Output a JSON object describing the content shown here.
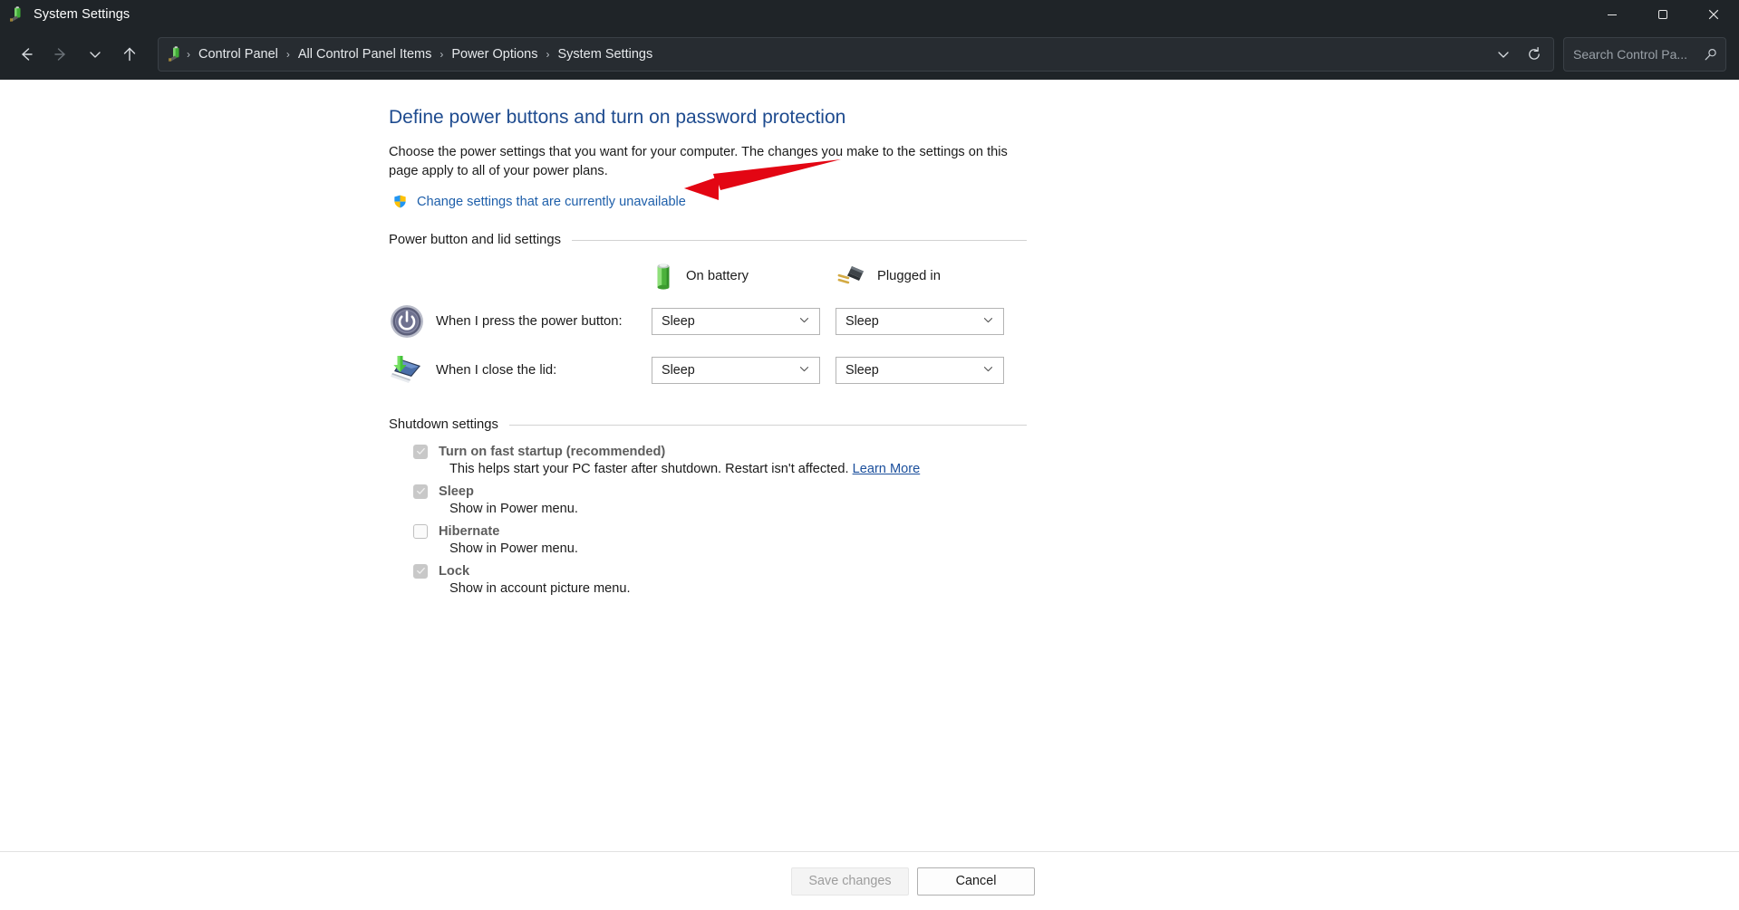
{
  "window": {
    "title": "System Settings",
    "icon": "battery-plug-icon",
    "minimize_label": "Minimize",
    "maximize_label": "Maximize",
    "close_label": "Close"
  },
  "nav": {
    "back_label": "Back",
    "forward_label": "Forward",
    "recent_label": "Recent locations",
    "up_label": "Up",
    "refresh_label": "Refresh",
    "dropdown_label": "Previous locations",
    "separator": "›",
    "breadcrumbs": [
      {
        "label": "Control Panel"
      },
      {
        "label": "All Control Panel Items"
      },
      {
        "label": "Power Options"
      },
      {
        "label": "System Settings"
      }
    ]
  },
  "search": {
    "placeholder": "Search Control Pa...",
    "value": "",
    "icon": "search-icon"
  },
  "page": {
    "title": "Define power buttons and turn on password protection",
    "description": "Choose the power settings that you want for your computer. The changes you make to the settings on this page apply to all of your power plans.",
    "uac_link": "Change settings that are currently unavailable",
    "uac_icon": "shield-icon"
  },
  "power_section": {
    "title": "Power button and lid settings",
    "columns": [
      {
        "label": "On battery",
        "icon": "battery-icon"
      },
      {
        "label": "Plugged in",
        "icon": "power-plug-icon"
      }
    ],
    "rows": [
      {
        "icon": "power-button-icon",
        "label": "When I press the power button:",
        "on_battery": "Sleep",
        "plugged_in": "Sleep",
        "arrow": "⌄"
      },
      {
        "icon": "laptop-lid-icon",
        "label": "When I close the lid:",
        "on_battery": "Sleep",
        "plugged_in": "Sleep",
        "arrow": "⌄"
      }
    ]
  },
  "shutdown_section": {
    "title": "Shutdown settings",
    "items": [
      {
        "label": "Turn on fast startup (recommended)",
        "checked": true,
        "description": "This helps start your PC faster after shutdown. Restart isn't affected.",
        "link": "Learn More"
      },
      {
        "label": "Sleep",
        "checked": true,
        "description": "Show in Power menu.",
        "link": ""
      },
      {
        "label": "Hibernate",
        "checked": false,
        "description": "Show in Power menu.",
        "link": ""
      },
      {
        "label": "Lock",
        "checked": true,
        "description": "Show in account picture menu.",
        "link": ""
      }
    ]
  },
  "footer": {
    "save_label": "Save changes",
    "cancel_label": "Cancel"
  },
  "colors": {
    "title_blue": "#1e4b8f",
    "link_blue": "#1e5faa",
    "titlebar_bg": "#1f2428",
    "annotation_red": "#e30613",
    "battery_green": "#5ac34a"
  },
  "annotation": {
    "type": "arrow",
    "points_to": "Change settings that are currently unavailable",
    "color": "#e30613"
  }
}
